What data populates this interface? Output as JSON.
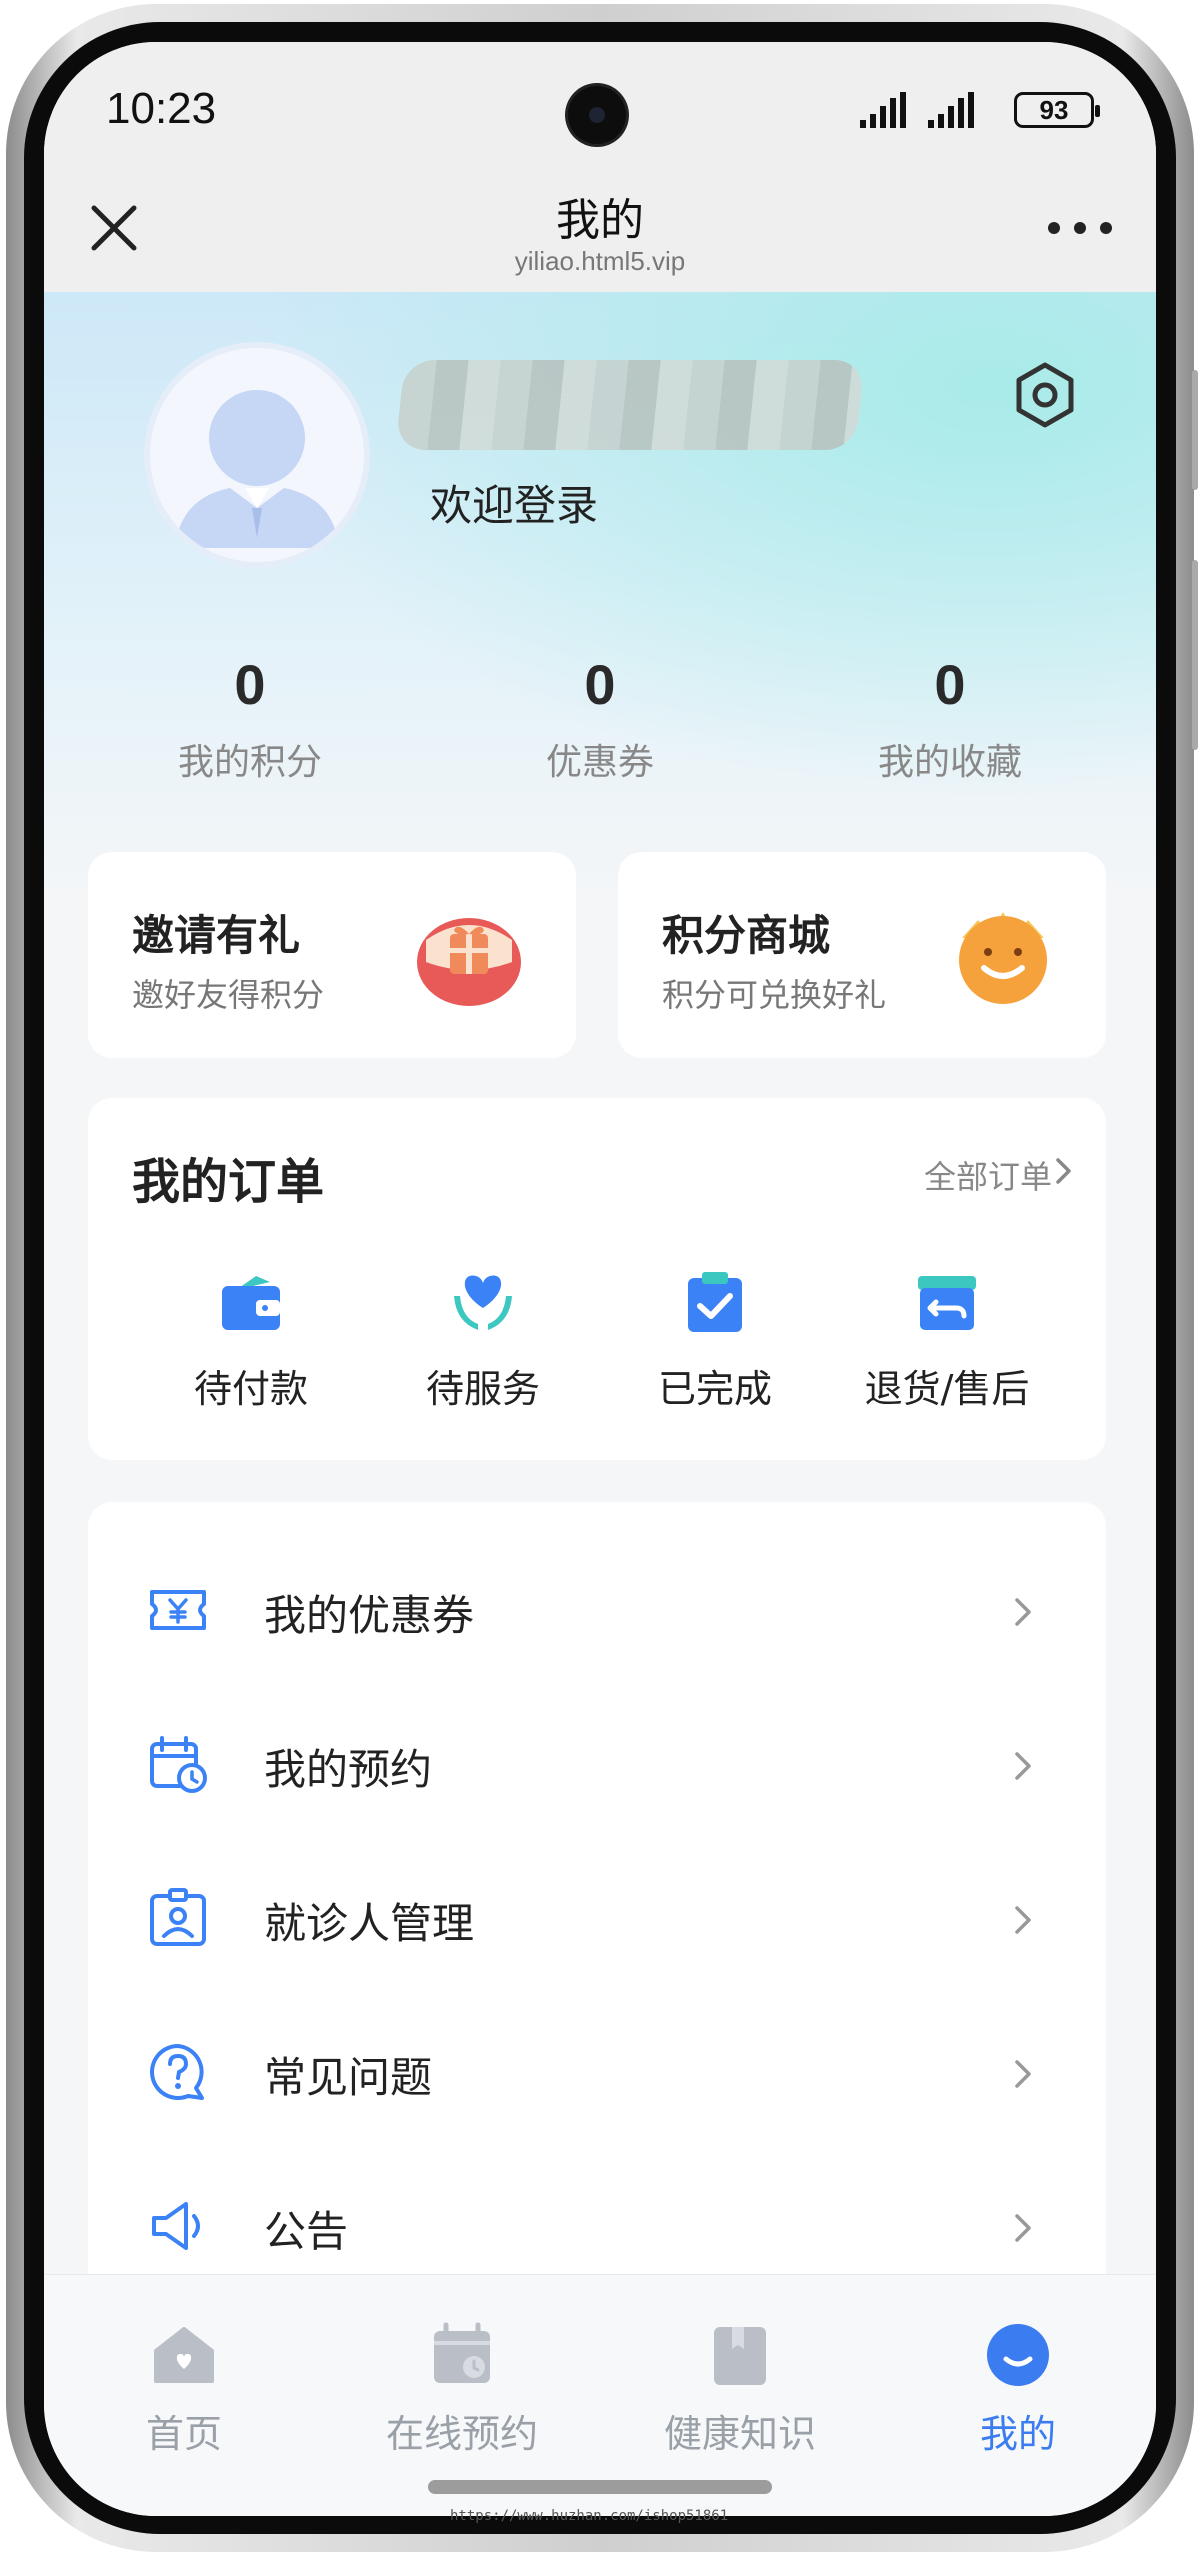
{
  "status_bar": {
    "time": "10:23",
    "battery": "93"
  },
  "nav": {
    "title": "我的",
    "url": "yiliao.html5.vip"
  },
  "profile": {
    "welcome": "欢迎登录"
  },
  "stats": [
    {
      "value": "0",
      "label": "我的积分"
    },
    {
      "value": "0",
      "label": "优惠券"
    },
    {
      "value": "0",
      "label": "我的收藏"
    }
  ],
  "promos": [
    {
      "title": "邀请有礼",
      "subtitle": "邀好友得积分",
      "icon": "gift-icon"
    },
    {
      "title": "积分商城",
      "subtitle": "积分可兑换好礼",
      "icon": "smile-crown-icon"
    }
  ],
  "orders": {
    "title": "我的订单",
    "all_label": "全部订单",
    "items": [
      {
        "label": "待付款",
        "icon": "wallet-icon"
      },
      {
        "label": "待服务",
        "icon": "heart-hands-icon"
      },
      {
        "label": "已完成",
        "icon": "clipboard-check-icon"
      },
      {
        "label": "退货/售后",
        "icon": "return-box-icon"
      }
    ]
  },
  "menu": [
    {
      "label": "我的优惠券",
      "icon": "coupon-icon"
    },
    {
      "label": "我的预约",
      "icon": "calendar-clock-icon"
    },
    {
      "label": "就诊人管理",
      "icon": "id-badge-icon"
    },
    {
      "label": "常见问题",
      "icon": "question-bubble-icon"
    },
    {
      "label": "公告",
      "icon": "speaker-icon"
    }
  ],
  "tabs": [
    {
      "label": "首页",
      "icon": "home-icon",
      "active": false
    },
    {
      "label": "在线预约",
      "icon": "calendar-icon",
      "active": false
    },
    {
      "label": "健康知识",
      "icon": "bookmark-icon",
      "active": false
    },
    {
      "label": "我的",
      "icon": "smile-icon",
      "active": true
    }
  ],
  "colors": {
    "accent": "#3b7cf1",
    "icon_blue": "#3b82f6",
    "icon_teal": "#3cc7c0",
    "gift_red": "#e55a57",
    "smile_orange": "#f6a23c"
  },
  "watermark": "https://www.huzhan.com/ishop51861"
}
